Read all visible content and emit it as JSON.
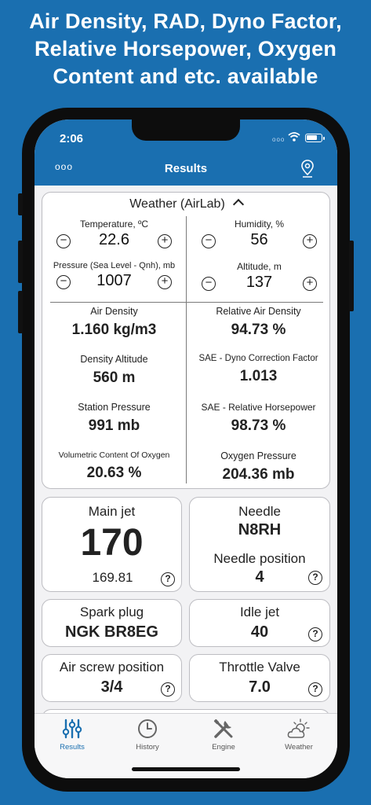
{
  "headline": {
    "line1": "Air Density, RAD, Dyno Factor,",
    "line2": "Relative Horsepower, Oxygen",
    "line3": "Content and etc. available"
  },
  "status": {
    "time": "2:06",
    "signal_dots": "ooo",
    "battery_level": 0.8
  },
  "navbar": {
    "menu_label": "ooo",
    "title": "Results",
    "location_icon": "location-pin-icon"
  },
  "weather": {
    "title": "Weather (AirLab)",
    "controls": {
      "temperature": {
        "label": "Temperature, ºC",
        "value": "22.6"
      },
      "humidity": {
        "label": "Humidity, %",
        "value": "56"
      },
      "pressure": {
        "label": "Pressure (Sea Level - Qnh), mb",
        "value": "1007"
      },
      "altitude": {
        "label": "Altitude, m",
        "value": "137"
      }
    },
    "minus_symbol": "−",
    "plus_symbol": "+",
    "metrics": {
      "air_density": {
        "label": "Air Density",
        "value": "1.160 kg/m3"
      },
      "relative_air_density": {
        "label": "Relative Air Density",
        "value": "94.73 %"
      },
      "density_altitude": {
        "label": "Density Altitude",
        "value": "560 m"
      },
      "dyno_factor": {
        "label": "SAE - Dyno Correction Factor",
        "value": "1.013"
      },
      "station_pressure": {
        "label": "Station Pressure",
        "value": "991 mb"
      },
      "relative_horsepower": {
        "label": "SAE - Relative Horsepower",
        "value": "98.73 %"
      },
      "oxygen_content": {
        "label": "Volumetric Content Of Oxygen",
        "value": "20.63 %"
      },
      "oxygen_pressure": {
        "label": "Oxygen Pressure",
        "value": "204.36 mb"
      }
    }
  },
  "results": {
    "main_jet": {
      "label": "Main jet",
      "value": "170",
      "exact": "169.81"
    },
    "needle": {
      "label": "Needle",
      "value": "N8RH",
      "position_label": "Needle position",
      "position_value": "4"
    },
    "spark_plug": {
      "label": "Spark plug",
      "value": "NGK BR8EG"
    },
    "idle_jet": {
      "label": "Idle jet",
      "value": "40"
    },
    "air_screw": {
      "label": "Air screw position",
      "value": "3/4"
    },
    "throttle_valve": {
      "label": "Throttle Valve",
      "value": "7.0"
    },
    "help_symbol": "?"
  },
  "tabs": [
    {
      "label": "Results",
      "icon": "sliders-icon",
      "active": true
    },
    {
      "label": "History",
      "icon": "clock-icon",
      "active": false
    },
    {
      "label": "Engine",
      "icon": "tools-icon",
      "active": false
    },
    {
      "label": "Weather",
      "icon": "cloud-sun-icon",
      "active": false
    }
  ],
  "colors": {
    "brand": "#1a6fb0",
    "card_border": "#bdbdc2",
    "text": "#222222"
  }
}
